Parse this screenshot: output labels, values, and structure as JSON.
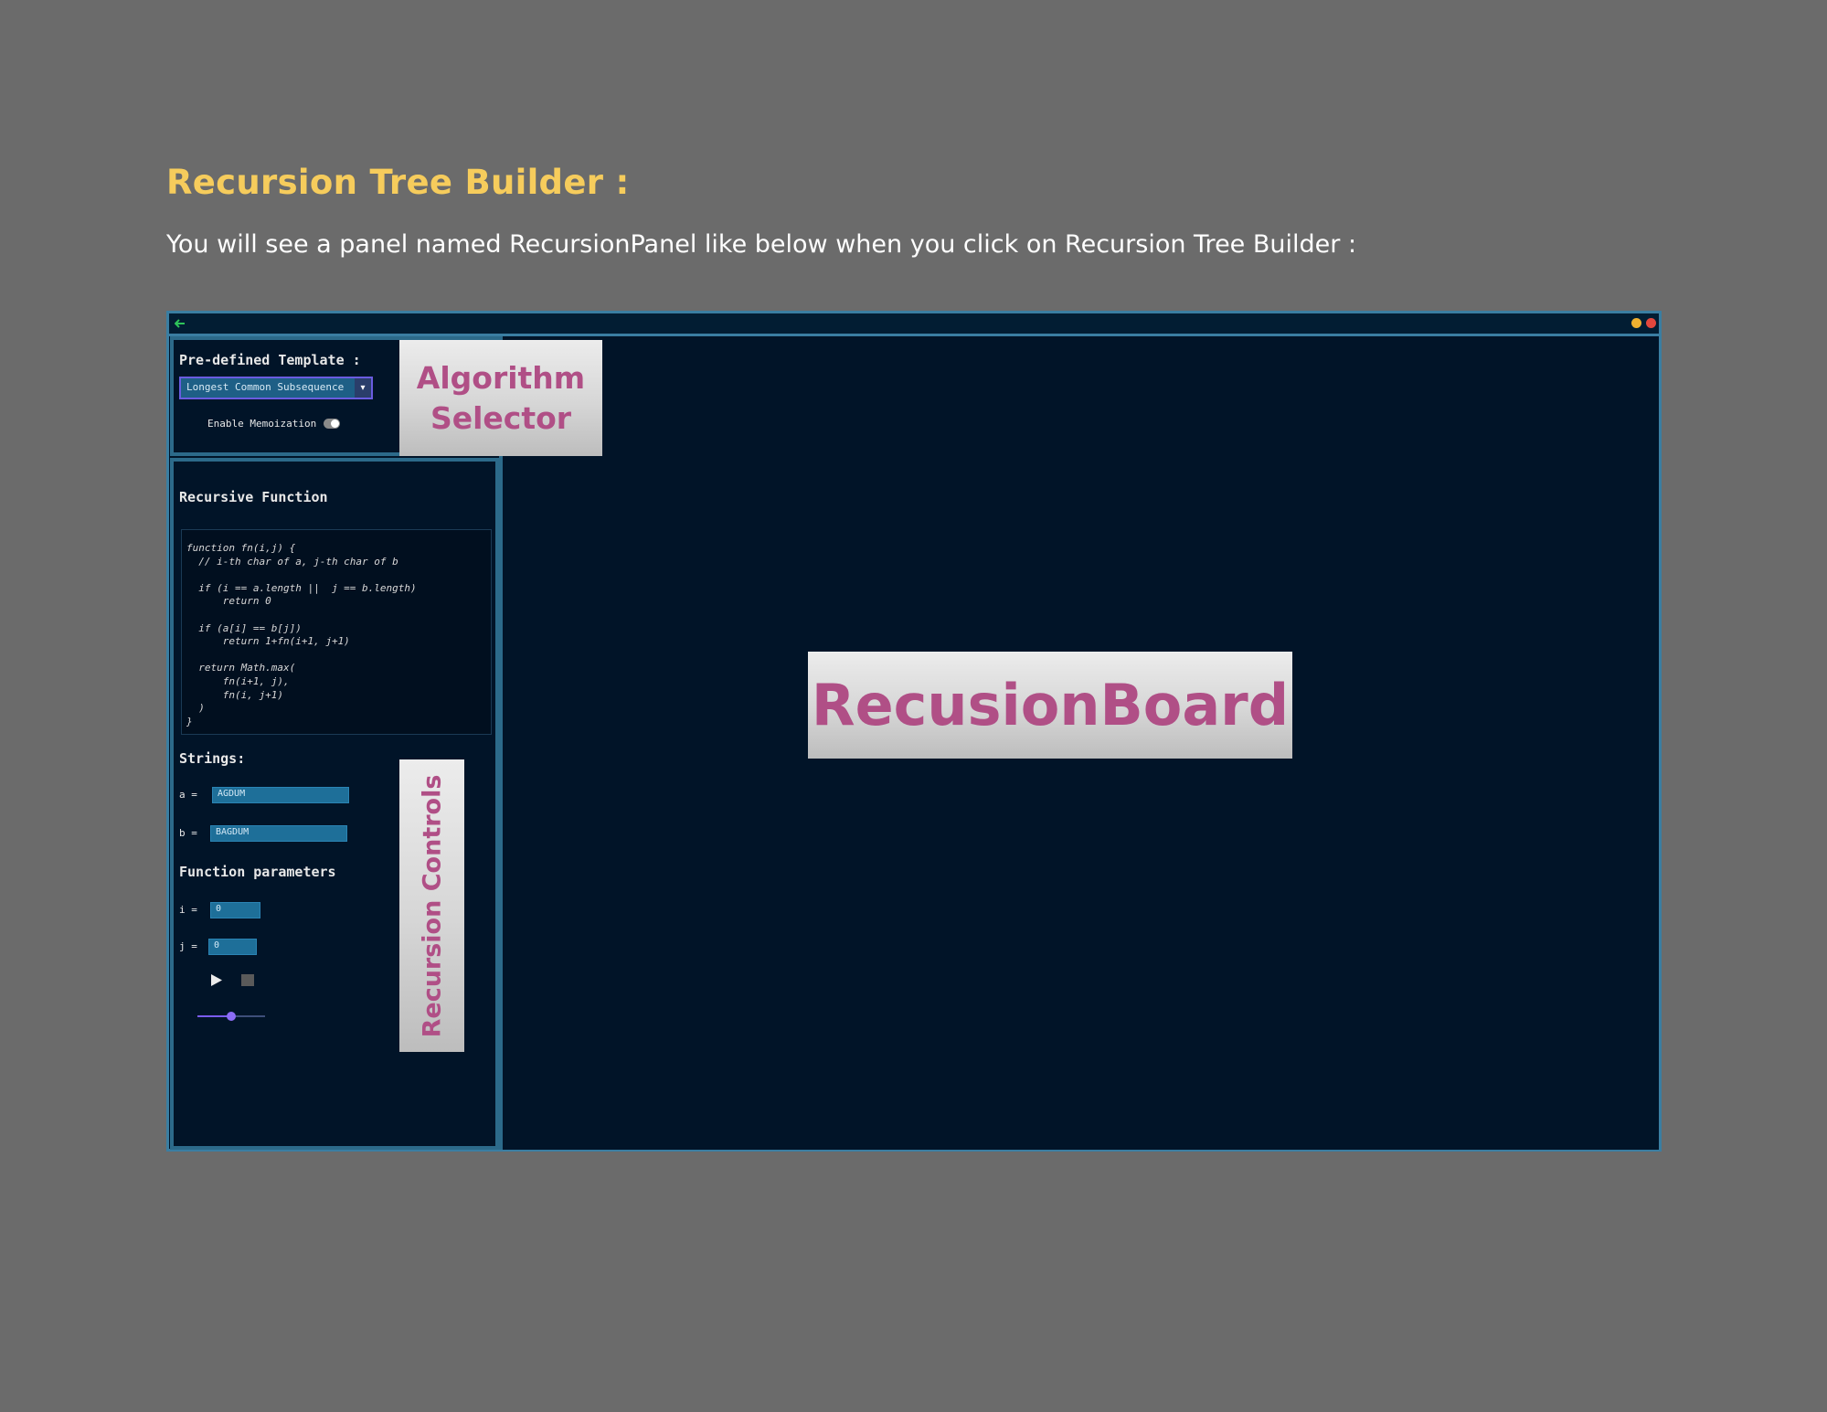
{
  "doc": {
    "title": "Recursion Tree Builder :",
    "description": "You will see a panel named RecursionPanel like below when you click on Recursion Tree Builder :"
  },
  "colors": {
    "title_yellow": "#f6cc5c",
    "panel_bg": "#011428",
    "border_blue": "#3a7ea2",
    "field_blue": "#1e6f99",
    "label_pink": "#b04f86",
    "slider_purple": "#7a5cf0"
  },
  "window": {
    "back_icon": "back-arrow-icon",
    "minimize_icon": "minimize-dot-icon",
    "close_icon": "close-dot-icon"
  },
  "selector": {
    "template_label": "Pre-defined Template :",
    "template_value": "Longest Common Subsequence",
    "memo_label": "Enable Memoization",
    "memo_enabled": true
  },
  "controls": {
    "function_title": "Recursive Function",
    "code": "function fn(i,j) {\n  // i-th char of a, j-th char of b\n\n  if (i == a.length ||  j == b.length)\n      return 0\n\n  if (a[i] == b[j])\n      return 1+fn(i+1, j+1)\n\n  return Math.max(\n      fn(i+1, j),\n      fn(i, j+1)\n  )\n}",
    "strings_title": "Strings:",
    "a_label": "a =",
    "a_value": "AGDUM",
    "b_label": "b =",
    "b_value": "BAGDUM",
    "params_title": "Function parameters",
    "i_label": "i =",
    "i_value": "0",
    "j_label": "j =",
    "j_value": "0",
    "speed_level": 0.5
  },
  "overlays": {
    "algorithm_selector": "Algorithm Selector",
    "recursion_board": "RecusionBoard",
    "recursion_controls": "Recursion Controls"
  }
}
